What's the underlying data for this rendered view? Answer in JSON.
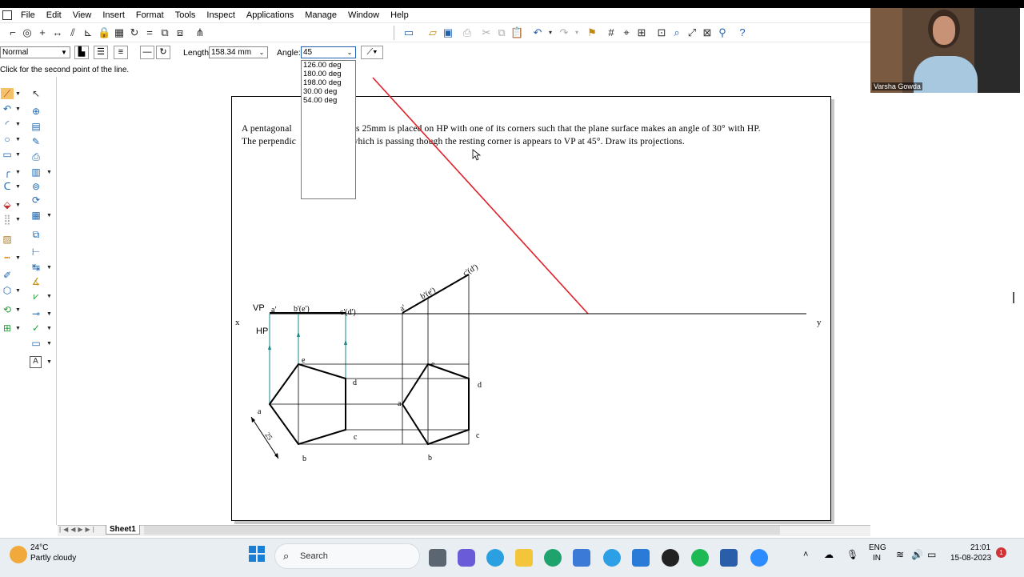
{
  "menu": [
    "File",
    "Edit",
    "View",
    "Insert",
    "Format",
    "Tools",
    "Inspect",
    "Applications",
    "Manage",
    "Window",
    "Help"
  ],
  "toolbar2": {
    "style_value": "Normal",
    "length_label": "Length:",
    "length_value": "158.34 mm",
    "angle_label": "Angle:",
    "angle_value": "45"
  },
  "angle_options": [
    "126.00 deg",
    "180.00 deg",
    "198.00 deg",
    "30.00 deg",
    "54.00 deg"
  ],
  "status_prompt": "Click for the second point of the line.",
  "problem": {
    "line1_a": "A pentagonal",
    "line1_b": "ges 25mm is placed on HP with one of its corners such that the plane surface makes an angle of 30° with HP.",
    "line2_a": "The perpendic",
    "line2_b": "which is passing though the resting corner is appears to VP at 45°. Draw its projections."
  },
  "drawing_labels": {
    "x": "x",
    "y": "y",
    "vp": "VP",
    "hp": "HP",
    "a1": "a'",
    "be1": "b'(e')",
    "cd1": "c'(d')",
    "a2": "a'",
    "be2": "b'(e')",
    "cd2": "c'(d')",
    "e1": "e",
    "d1": "d",
    "a_top": "a",
    "c1": "c",
    "b1": "b",
    "e2": "e",
    "d2": "d",
    "a2t": "a",
    "c2": "c",
    "b2": "b",
    "dim": "25"
  },
  "sheet_tab": "Sheet1",
  "video": {
    "name": "Varsha Gowda"
  },
  "taskbar": {
    "temp": "24°C",
    "weather": "Partly cloudy",
    "search_placeholder": "Search",
    "lang1": "ENG",
    "lang2": "IN",
    "time": "21:01",
    "date": "15-08-2023",
    "notif": "1"
  },
  "colors": {
    "construction_line": "#e0202a",
    "projector": "#1a8a8a",
    "accent": "#2060b0"
  }
}
